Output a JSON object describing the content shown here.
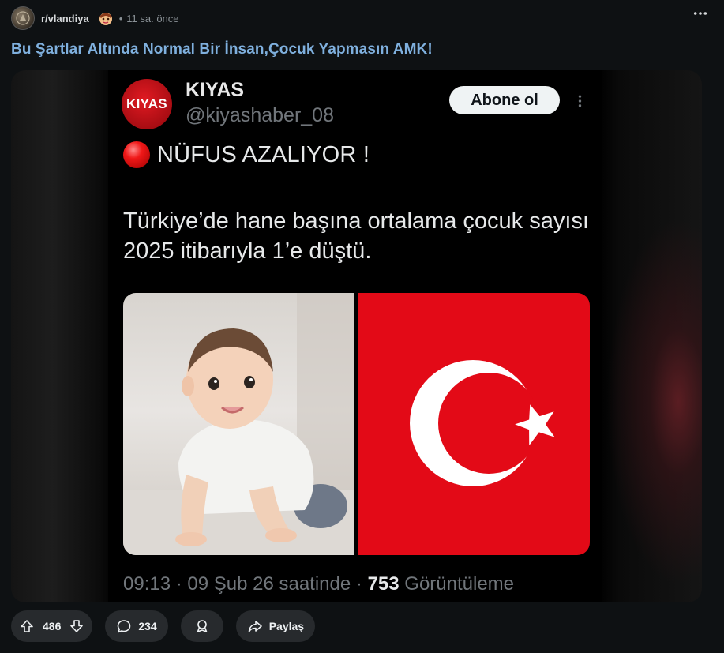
{
  "post": {
    "subreddit": "r/vlandiya",
    "separator": "•",
    "time": "11 sa. önce",
    "title": "Bu Şartlar Altında Normal Bir İnsan,Çocuk Yapmasın AMK!",
    "icons": {
      "more": "more-horizontal-icon",
      "subreddit_avatar": "subreddit-avatar",
      "flair": "flair-icon"
    }
  },
  "tweet": {
    "avatar_text": "KIYAS",
    "name": "KIYAS",
    "handle": "@kiyashaber_08",
    "follow_label": "Abone ol",
    "headline": "NÜFUS AZALIYOR !",
    "body": "Türkiye’de hane başına ortalama çocuk sayısı 2025 itibarıyla 1’e düştü.",
    "meta_prefix": "09:13 · 09 Şub 26 saatinde · ",
    "views": "753",
    "views_label": " Görüntüleme",
    "images": [
      "baby-photo",
      "turkish-flag"
    ]
  },
  "actions": {
    "upvotes": "486",
    "comments": "234",
    "share_label": "Paylaş",
    "icons": [
      "upvote-icon",
      "downvote-icon",
      "comment-icon",
      "award-icon",
      "share-icon"
    ]
  },
  "colors": {
    "background": "#0e1113",
    "title_link": "#7fb0de",
    "pill": "#272a2d",
    "flag_red": "#e30a17",
    "kiyas_red": "#c8121a"
  }
}
